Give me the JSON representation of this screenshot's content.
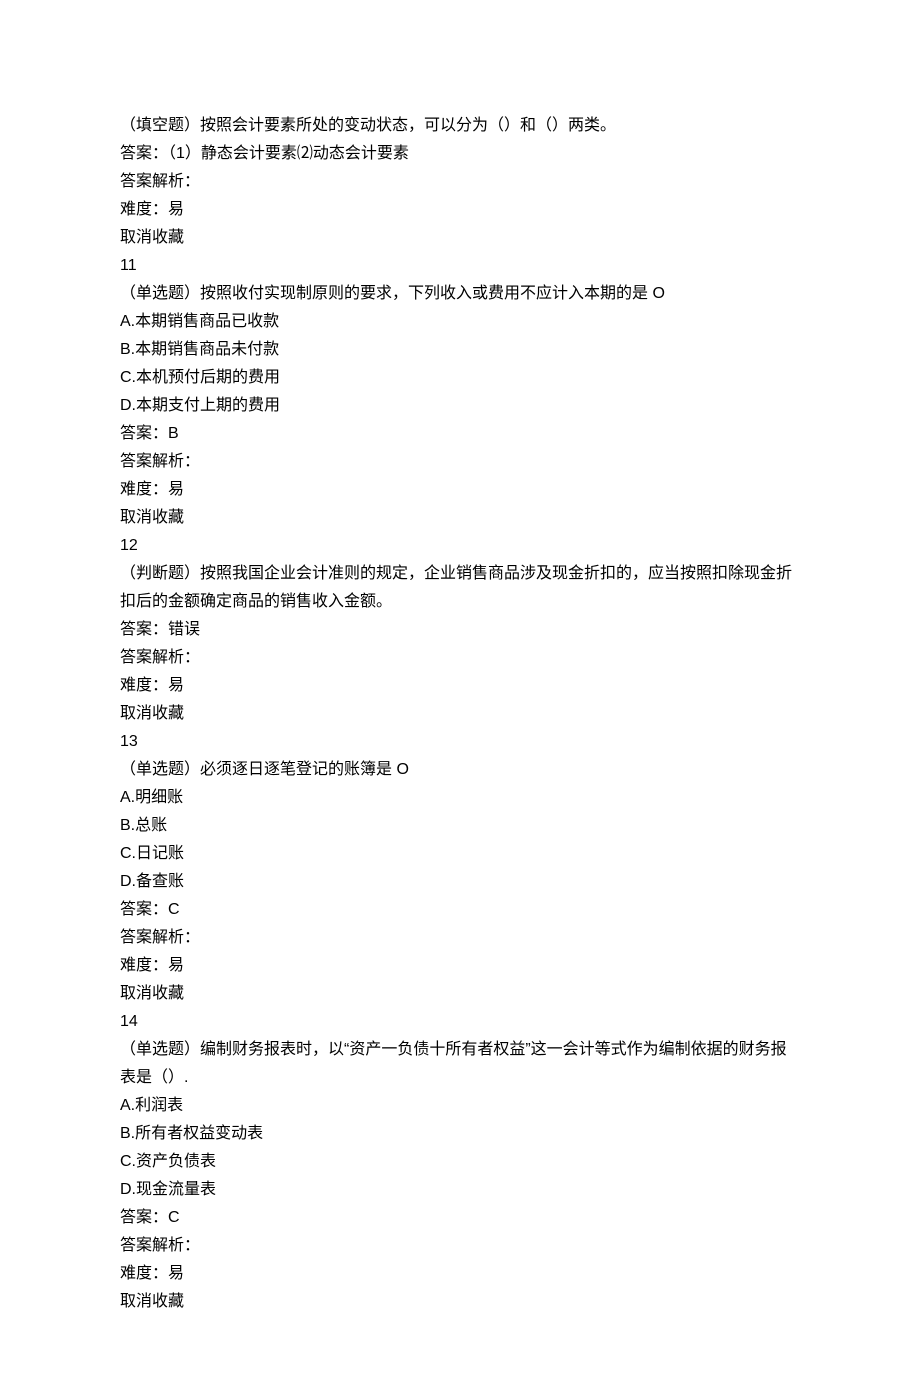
{
  "q10": {
    "stem": "（填空题）按照会计要素所处的变动状态，可以分为（）和（）两类。",
    "answer_label": "答案：（1）静态会计要素⑵动态会计要素",
    "analysis_label": "答案解析：",
    "difficulty_label": "难度：易",
    "fav_label": "取消收藏"
  },
  "q11": {
    "number": "11",
    "stem": "（单选题）按照收付实现制原则的要求，下列收入或费用不应计入本期的是 O",
    "optA": "A.本期销售商品已收款",
    "optB": "B.本期销售商品未付款",
    "optC": "C.本机预付后期的费用",
    "optD": "D.本期支付上期的费用",
    "answer_label": "答案：B",
    "analysis_label": "答案解析：",
    "difficulty_label": "难度：易",
    "fav_label": "取消收藏"
  },
  "q12": {
    "number": "12",
    "stem": "（判断题）按照我国企业会计准则的规定，企业销售商品涉及现金折扣的，应当按照扣除现金折扣后的金额确定商品的销售收入金额。",
    "answer_label": "答案：错误",
    "analysis_label": "答案解析：",
    "difficulty_label": "难度：易",
    "fav_label": "取消收藏"
  },
  "q13": {
    "number": "13",
    "stem": "（单选题）必须逐日逐笔登记的账簿是 O",
    "optA": "A.明细账",
    "optB": "B.总账",
    "optC": "C.日记账",
    "optD": "D.备查账",
    "answer_label": "答案：C",
    "analysis_label": "答案解析：",
    "difficulty_label": "难度：易",
    "fav_label": "取消收藏"
  },
  "q14": {
    "number": "14",
    "stem": "（单选题）编制财务报表时，以“资产一负债十所有者权益”这一会计等式作为编制依据的财务报表是（）.",
    "optA": "A.利润表",
    "optB": "B.所有者权益变动表",
    "optC": "C.资产负债表",
    "optD": "D.现金流量表",
    "answer_label": "答案：C",
    "analysis_label": "答案解析：",
    "difficulty_label": "难度：易",
    "fav_label": "取消收藏"
  }
}
